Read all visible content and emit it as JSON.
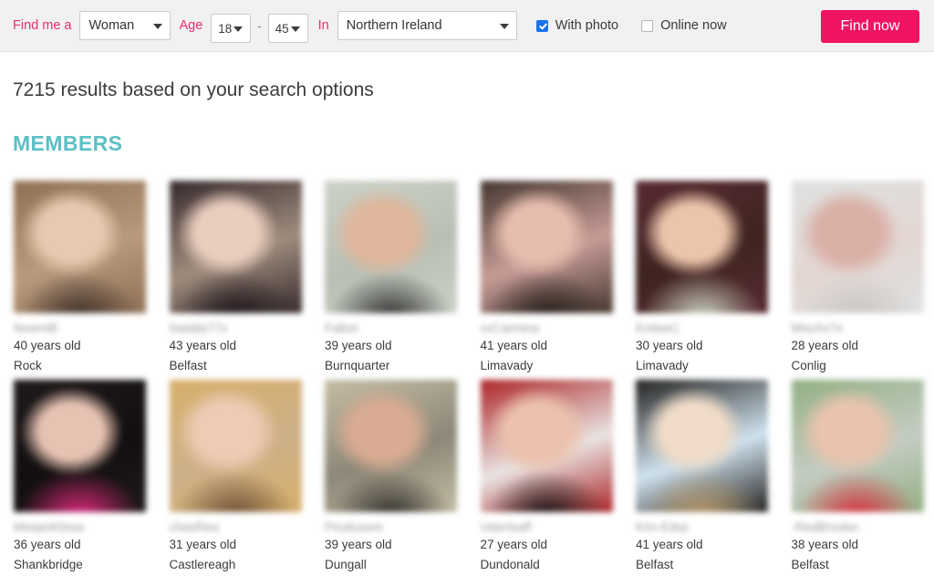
{
  "searchbar": {
    "find_me_a_label": "Find me a",
    "gender_value": "Woman",
    "age_label": "Age",
    "age_min": "18",
    "age_dash": "-",
    "age_max": "45",
    "in_label": "In",
    "region_value": "Northern Ireland",
    "with_photo_label": "With photo",
    "with_photo_checked": true,
    "online_now_label": "Online now",
    "online_now_checked": false,
    "find_now_label": "Find now",
    "accent_color": "#f01462",
    "label_color": "#e8306d",
    "checkbox_color": "#1a73e8",
    "bar_background": "#f1f1f1"
  },
  "results": {
    "count_text": "7215 results based on your search options",
    "section_title": "MEMBERS",
    "section_title_color": "#5bc0c4"
  },
  "members": [
    {
      "username": "NoemiB",
      "age": "40 years old",
      "city": "Rock",
      "c1": "#8c6d52",
      "c2": "#e7c9b0",
      "c3": "#3a2c25",
      "c4": "#b99a7e"
    },
    {
      "username": "Natalie77x",
      "age": "43 years old",
      "city": "Belfast",
      "c1": "#2e2226",
      "c2": "#e9cdbe",
      "c3": "#1d1519",
      "c4": "#9f8c7d"
    },
    {
      "username": "Fallon",
      "age": "39 years old",
      "city": "Burnquarter",
      "c1": "#cdd3c8",
      "c2": "#e0b69c",
      "c3": "#2b2b2b",
      "c4": "#b9bfb4"
    },
    {
      "username": "xxCarmina",
      "age": "41 years old",
      "city": "Limavady",
      "c1": "#3b3028",
      "c2": "#e7bdae",
      "c3": "#241c18",
      "c4": "#c79b96"
    },
    {
      "username": "EmleeC",
      "age": "30 years old",
      "city": "Limavady",
      "c1": "#5a2b33",
      "c2": "#ecc4ab",
      "c3": "#cfd6c4",
      "c4": "#3e2420"
    },
    {
      "username": "Mischy7x",
      "age": "28 years old",
      "city": "Conlig",
      "c1": "#dfe3e3",
      "c2": "#d9b0a6",
      "c3": "#c9c4c0",
      "c4": "#e3d6d2"
    },
    {
      "username": "MeganKlissa",
      "age": "36 years old",
      "city": "Shankbridge",
      "c1": "#201a1b",
      "c2": "#e6c2b3",
      "c3": "#e2297f",
      "c4": "#120e0f"
    },
    {
      "username": "chepReg",
      "age": "31 years old",
      "city": "Castlereagh",
      "c1": "#d9b06a",
      "c2": "#edcbb4",
      "c3": "#6a4a33",
      "c4": "#cdb088"
    },
    {
      "username": "Pinalusere",
      "age": "39 years old",
      "city": "Dungall",
      "c1": "#c9c1a8",
      "c2": "#d8ab92",
      "c3": "#2a2724",
      "c4": "#8d8778"
    },
    {
      "username": "Valerieaff",
      "age": "27 years old",
      "city": "Dundonald",
      "c1": "#a8161a",
      "c2": "#ecc2ad",
      "c3": "#121010",
      "c4": "#e9e4e2"
    },
    {
      "username": "Kim-Edgz",
      "age": "41 years old",
      "city": "Belfast",
      "c1": "#151210",
      "c2": "#f0dcc8",
      "c3": "#b99a68",
      "c4": "#cfe2ee"
    },
    {
      "username": "-RedBrooke-",
      "age": "38 years old",
      "city": "Belfast",
      "c1": "#8fae80",
      "c2": "#e9c3ad",
      "c3": "#d92a3a",
      "c4": "#c4ccc2"
    }
  ]
}
